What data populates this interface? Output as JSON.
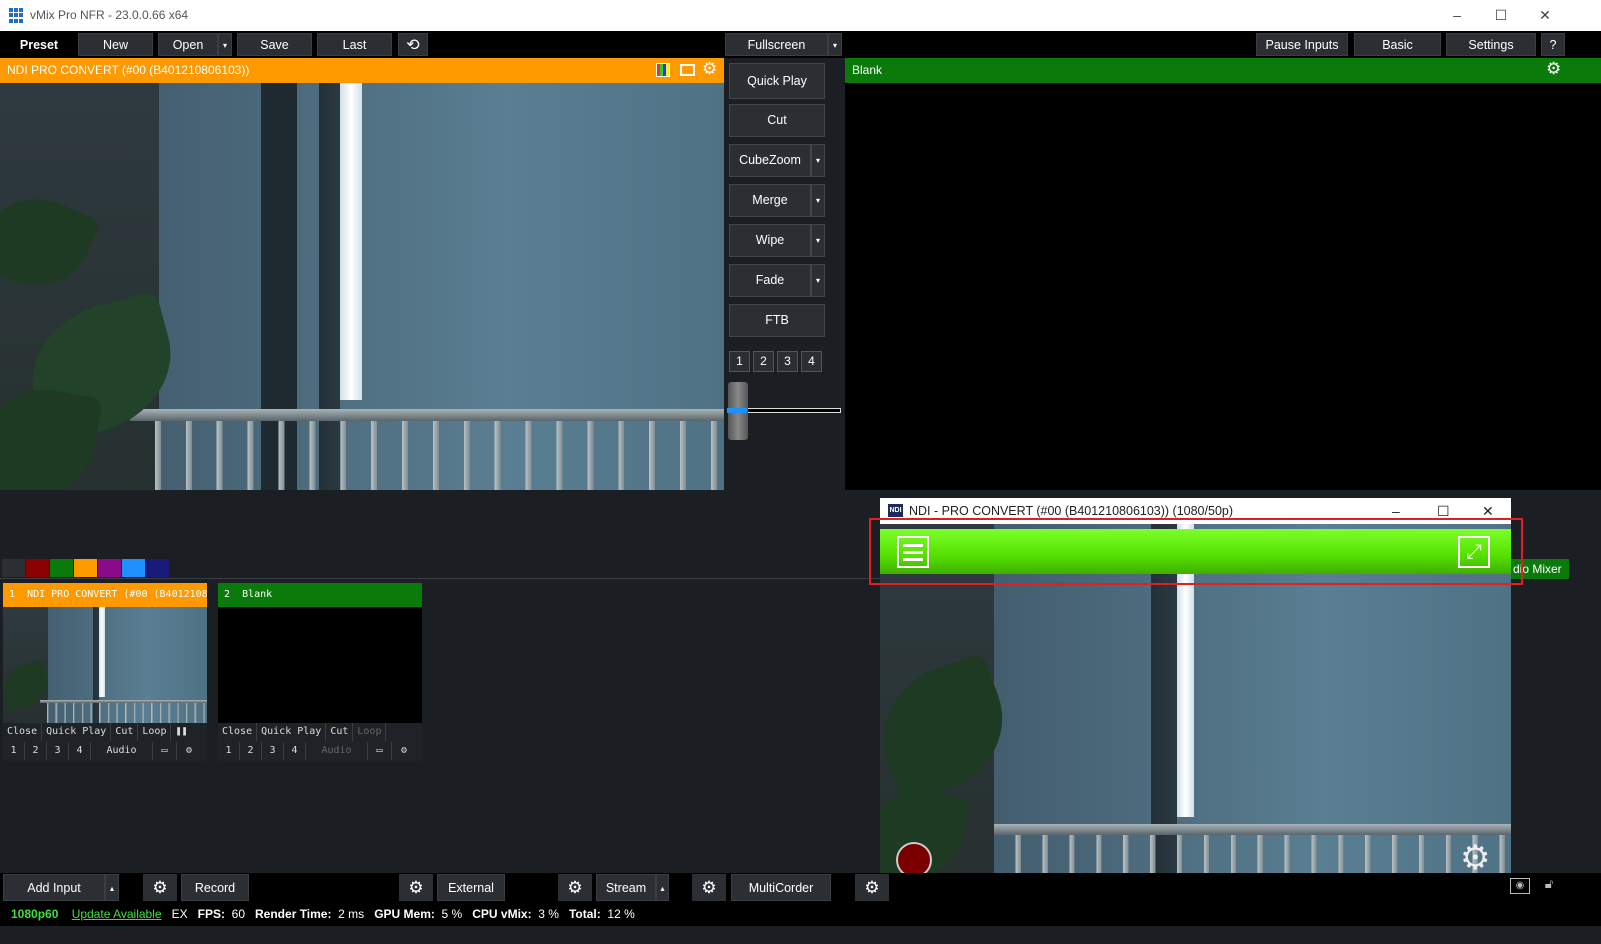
{
  "window": {
    "title": "vMix Pro NFR - 23.0.0.66 x64",
    "minimize": "–",
    "maximize": "☐",
    "close": "✕"
  },
  "toolbar": {
    "preset": "Preset",
    "new": "New",
    "open": "Open",
    "save": "Save",
    "last": "Last",
    "fullscreen": "Fullscreen",
    "pause_inputs": "Pause Inputs",
    "basic": "Basic",
    "settings": "Settings",
    "help": "?"
  },
  "preview": {
    "title": "NDI PRO CONVERT (#00 (B401210806103))",
    "header_color": "#ff9900"
  },
  "program": {
    "title": "Blank",
    "header_color": "#0a7a0a"
  },
  "transitions": {
    "quick_play": "Quick Play",
    "cut": "Cut",
    "cubezoom": "CubeZoom",
    "merge": "Merge",
    "wipe": "Wipe",
    "fade": "Fade",
    "ftb": "FTB",
    "numbers": [
      "1",
      "2",
      "3",
      "4"
    ]
  },
  "swatches": [
    "#2b2e33",
    "#8b0000",
    "#0a7a0a",
    "#ff9900",
    "#8a0b8a",
    "#1e90ff",
    "#1a1a7a"
  ],
  "inputs": [
    {
      "number": "1",
      "name": "NDI PRO CONVERT (#00 (B401210806103))",
      "color": "#ff9900",
      "buttons": [
        "Close",
        "Quick Play",
        "Cut",
        "Loop"
      ],
      "slots": [
        "1",
        "2",
        "3",
        "4"
      ],
      "audio": "Audio"
    },
    {
      "number": "2",
      "name": "Blank",
      "color": "#0a7a0a",
      "buttons": [
        "Close",
        "Quick Play",
        "Cut",
        "Loop"
      ],
      "slots": [
        "1",
        "2",
        "3",
        "4"
      ],
      "audio": "Audio"
    }
  ],
  "ndi_window": {
    "title": "NDI - PRO CONVERT (#00 (B401210806103)) (1080/50p)",
    "icon_text": "NDI",
    "menu_icon": "hamburger-icon",
    "expand_icon": "expand-icon"
  },
  "audio_mixer_label": "dio Mixer",
  "bottom": {
    "add_input": "Add Input",
    "record": "Record",
    "external": "External",
    "stream": "Stream",
    "multicorder": "MultiCorder"
  },
  "status": {
    "format": "1080p60",
    "update": "Update Available",
    "ex": "EX",
    "fps_label": "FPS:",
    "fps": "60",
    "render_label": "Render Time:",
    "render": "2 ms",
    "gpu_label": "GPU Mem:",
    "gpu": "5 %",
    "cpu_label": "CPU vMix:",
    "cpu": "3 %",
    "total_label": "Total:",
    "total": "12 %"
  }
}
